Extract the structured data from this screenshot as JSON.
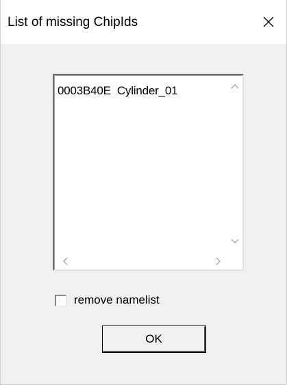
{
  "window": {
    "title": "List of missing ChipIds"
  },
  "list": {
    "items": [
      "0003B40E  Cylinder_01"
    ]
  },
  "remove_namelist": {
    "label": "remove namelist",
    "checked": false
  },
  "ok_button": {
    "label": "OK"
  },
  "icons": {
    "close": "close-icon",
    "scroll_up": "chevron-up-icon",
    "scroll_down": "chevron-down-icon",
    "scroll_left": "chevron-left-icon",
    "scroll_right": "chevron-right-icon"
  }
}
